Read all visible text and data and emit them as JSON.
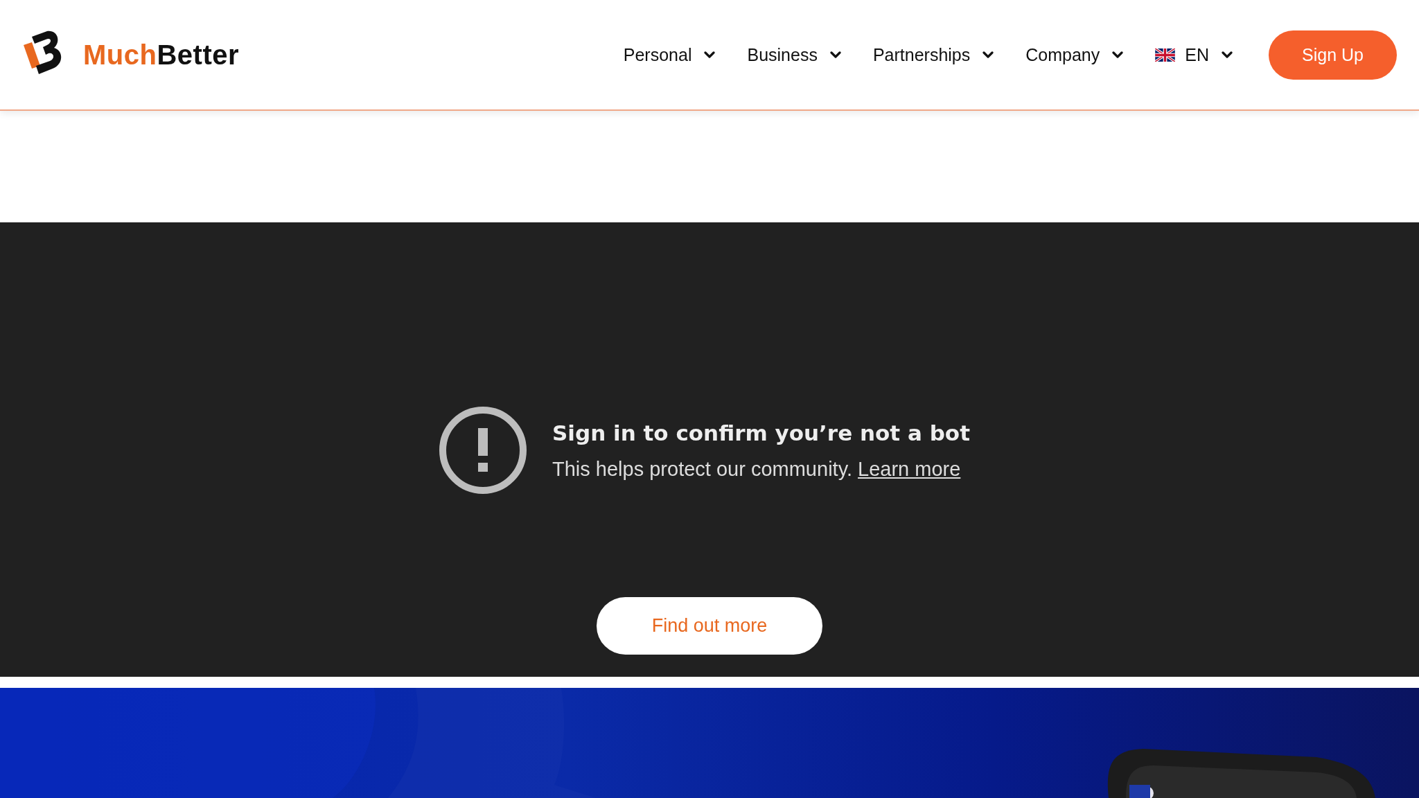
{
  "header": {
    "logo": {
      "first": "Much",
      "second": "Better"
    },
    "nav": [
      {
        "label": "Personal"
      },
      {
        "label": "Business"
      },
      {
        "label": "Partnerships"
      },
      {
        "label": "Company"
      }
    ],
    "language": {
      "code": "EN"
    },
    "signup": "Sign Up"
  },
  "video": {
    "title": "Sign in to confirm you’re not a bot",
    "message": "This helps protect our community.",
    "link": "Learn more"
  },
  "cta": "Find out more"
}
